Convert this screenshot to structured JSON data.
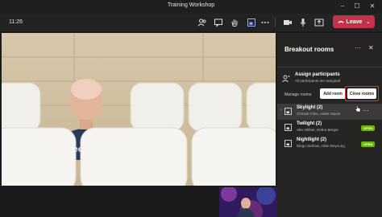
{
  "window": {
    "title": "Training Workshop",
    "controls": [
      "minimize-icon",
      "maximize-icon",
      "close-icon"
    ]
  },
  "toolbar": {
    "timer": "11:26",
    "icons": [
      "participants-icon",
      "chat-icon",
      "raise-hand-icon",
      "breakout-rooms-icon",
      "more-options-icon",
      "camera-icon",
      "mic-icon",
      "share-icon"
    ],
    "leave_label": "Leave",
    "leave_color": "#c4314b"
  },
  "panel": {
    "title": "Breakout rooms",
    "assign": {
      "title": "Assign participants",
      "subtitle": "All participants are assigned"
    },
    "manage_label": "Manage rooms",
    "add_room_label": "Add room",
    "close_rooms_label": "Close rooms",
    "rooms": [
      {
        "name": "Skylight (2)",
        "members": "Christie Cline, Adele Vance",
        "status": "",
        "selected": true
      },
      {
        "name": "Twilight (2)",
        "members": "Alex Wilber, Debra Berger",
        "status": "OPEN",
        "selected": false
      },
      {
        "name": "Nightlight (2)",
        "members": "Diego Siciliani, Allan Deyoung",
        "status": "OPEN",
        "selected": false
      }
    ],
    "open_color": "#6bb700",
    "highlight_color": "#e0303a"
  }
}
